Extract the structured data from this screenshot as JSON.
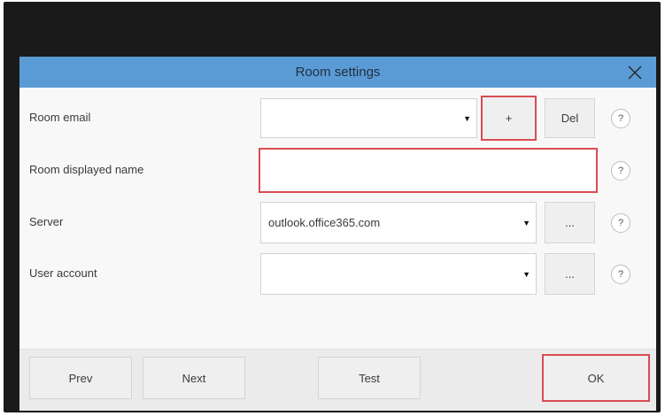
{
  "dialog": {
    "title": "Room settings"
  },
  "rows": {
    "room_email": {
      "label": "Room email",
      "value": "",
      "add_label": "+",
      "del_label": "Del",
      "help": "?"
    },
    "room_name": {
      "label": "Room displayed name",
      "value": "",
      "help": "?"
    },
    "server": {
      "label": "Server",
      "value": "outlook.office365.com",
      "browse_label": "...",
      "help": "?"
    },
    "user_account": {
      "label": "User account",
      "value": "",
      "browse_label": "...",
      "help": "?"
    }
  },
  "footer": {
    "prev_label": "Prev",
    "next_label": "Next",
    "test_label": "Test",
    "ok_label": "OK"
  },
  "colors": {
    "titlebar": "#5b9bd5",
    "highlight": "#d94c53",
    "frame": "#1a1a1a"
  }
}
